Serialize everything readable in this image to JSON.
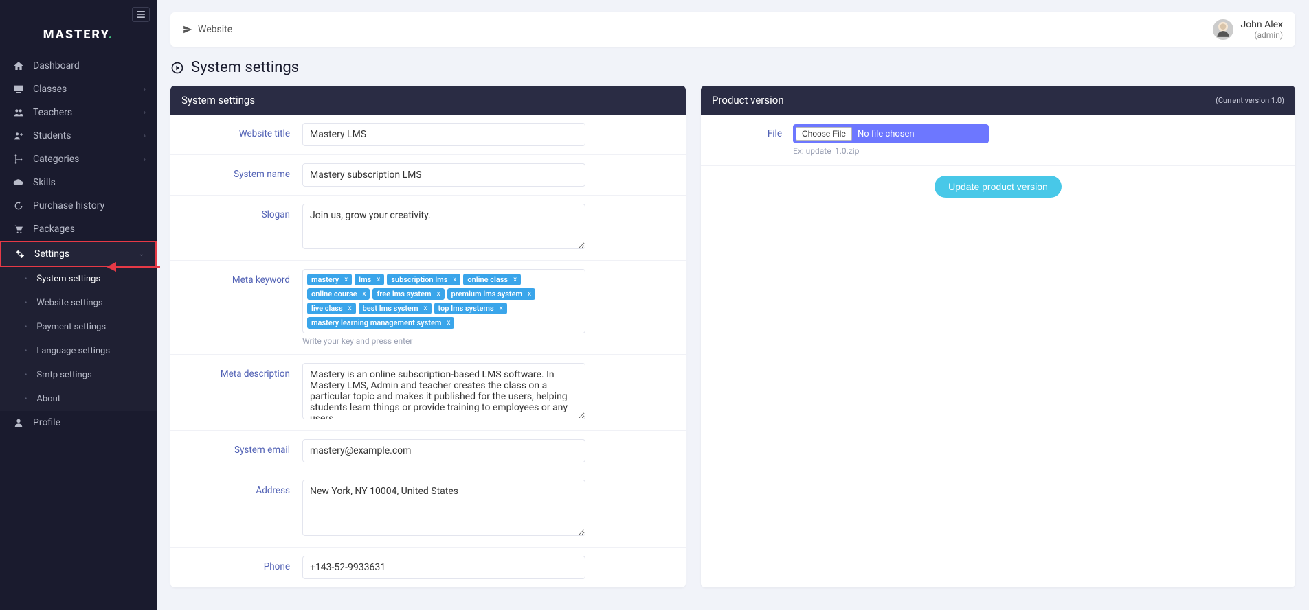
{
  "brand": {
    "name": "MASTERY"
  },
  "topbar": {
    "website_link": "Website"
  },
  "user": {
    "name": "John Alex",
    "role": "(admin)"
  },
  "page": {
    "title": "System settings"
  },
  "sidebar": {
    "items": [
      {
        "label": "Dashboard",
        "icon": "home"
      },
      {
        "label": "Classes",
        "icon": "chalkboard",
        "expandable": true
      },
      {
        "label": "Teachers",
        "icon": "users",
        "expandable": true
      },
      {
        "label": "Students",
        "icon": "users-plus",
        "expandable": true
      },
      {
        "label": "Categories",
        "icon": "branch",
        "expandable": true
      },
      {
        "label": "Skills",
        "icon": "cloud"
      },
      {
        "label": "Purchase history",
        "icon": "history"
      },
      {
        "label": "Packages",
        "icon": "cart"
      },
      {
        "label": "Settings",
        "icon": "gears",
        "expandable": true,
        "open": true,
        "highlighted": true
      },
      {
        "label": "Profile",
        "icon": "user"
      }
    ],
    "settings_sub": [
      {
        "label": "System settings",
        "current": true
      },
      {
        "label": "Website settings"
      },
      {
        "label": "Payment settings"
      },
      {
        "label": "Language settings"
      },
      {
        "label": "Smtp settings"
      },
      {
        "label": "About"
      }
    ]
  },
  "system_card": {
    "header": "System settings",
    "website_title": {
      "label": "Website title",
      "value": "Mastery LMS"
    },
    "system_name": {
      "label": "System name",
      "value": "Mastery subscription LMS"
    },
    "slogan": {
      "label": "Slogan",
      "value": "Join us, grow your creativity."
    },
    "meta_keyword": {
      "label": "Meta keyword",
      "tags": [
        "mastery",
        "lms",
        "subscription lms",
        "online class",
        "online course",
        "free lms system",
        "premium lms system",
        "live class",
        "best lms system",
        "top lms systems",
        "mastery learning management system"
      ],
      "hint": "Write your key and press enter"
    },
    "meta_description": {
      "label": "Meta description",
      "value": "Mastery is an online subscription-based LMS software. In Mastery LMS, Admin and teacher creates the class on a particular topic and makes it published for the users, helping students learn things or provide training to employees or any users."
    },
    "system_email": {
      "label": "System email",
      "value": "mastery@example.com"
    },
    "address": {
      "label": "Address",
      "value": "New York, NY 10004, United States"
    },
    "phone": {
      "label": "Phone",
      "value": "+143-52-9933631"
    }
  },
  "version_card": {
    "header": "Product version",
    "version_note": "(Current version 1.0)",
    "file_label": "File",
    "choose_button": "Choose File",
    "no_file": "No file chosen",
    "example": "Ex: update_1.0.zip",
    "update_button": "Update product version"
  }
}
